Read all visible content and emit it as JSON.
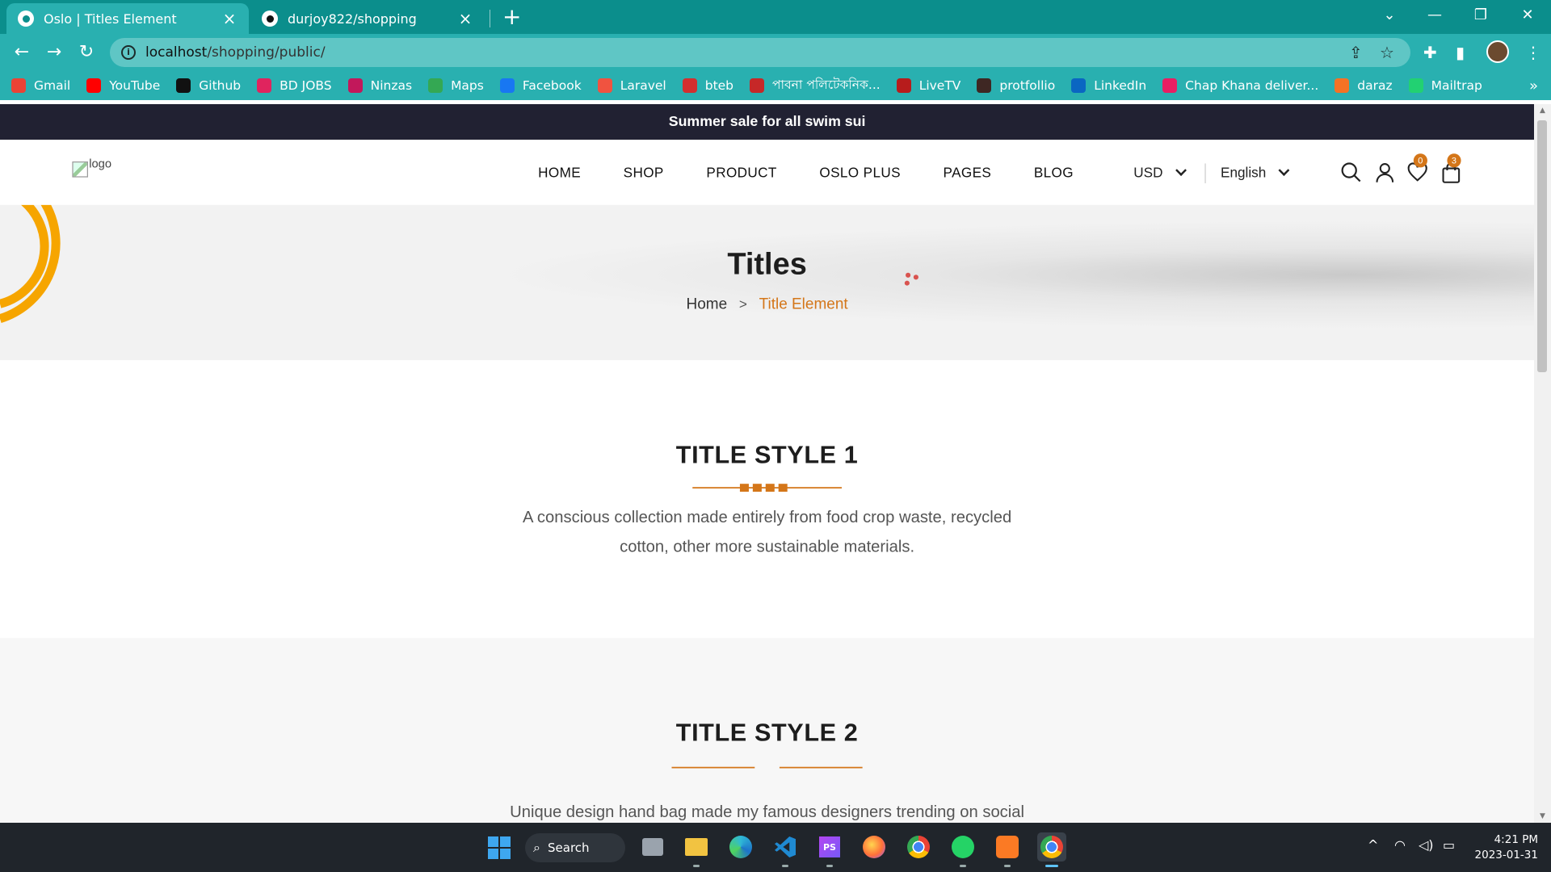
{
  "browser": {
    "tabs": [
      {
        "title": "Oslo | Titles Element",
        "active": true
      },
      {
        "title": "durjoy822/shopping",
        "active": false
      }
    ],
    "url_host": "localhost",
    "url_path": "/shopping/public/",
    "bookmarks": [
      {
        "label": "Gmail",
        "icon": "gmail-icon",
        "color": "#ea4335"
      },
      {
        "label": "YouTube",
        "icon": "youtube-icon",
        "color": "#ff0000"
      },
      {
        "label": "Github",
        "icon": "github-icon",
        "color": "#111111"
      },
      {
        "label": "BD JOBS",
        "icon": "bdjobs-icon",
        "color": "#e0245e"
      },
      {
        "label": "Ninzas",
        "icon": "ninzas-icon",
        "color": "#c2185b"
      },
      {
        "label": "Maps",
        "icon": "maps-icon",
        "color": "#34a853"
      },
      {
        "label": "Facebook",
        "icon": "facebook-icon",
        "color": "#1877f2"
      },
      {
        "label": "Laravel",
        "icon": "laravel-icon",
        "color": "#f05340"
      },
      {
        "label": "bteb",
        "icon": "bteb-icon",
        "color": "#d32f2f"
      },
      {
        "label": "পাবনা পলিটেকনিক...",
        "icon": "pabna-icon",
        "color": "#c62828"
      },
      {
        "label": "LiveTV",
        "icon": "livetv-icon",
        "color": "#b71c1c"
      },
      {
        "label": "protfollio",
        "icon": "portfolio-icon",
        "color": "#3e2723"
      },
      {
        "label": "LinkedIn",
        "icon": "linkedin-icon",
        "color": "#0a66c2"
      },
      {
        "label": "Chap Khana deliver...",
        "icon": "chapkhana-icon",
        "color": "#e91e63"
      },
      {
        "label": "daraz",
        "icon": "daraz-icon",
        "color": "#f57224"
      },
      {
        "label": "Mailtrap",
        "icon": "mailtrap-icon",
        "color": "#22d172"
      }
    ]
  },
  "site": {
    "announcement": "Summer sale for all swim sui",
    "logo_alt": "logo",
    "menu": [
      "HOME",
      "SHOP",
      "PRODUCT",
      "OSLO PLUS",
      "PAGES",
      "BLOG"
    ],
    "currency": "USD",
    "language": "English",
    "wishlist_count": "0",
    "cart_count": "3",
    "accent_color": "#d47619",
    "dark_color": "#212132"
  },
  "hero": {
    "title": "Titles",
    "breadcrumb_home": "Home",
    "breadcrumb_current": "Title Element"
  },
  "sections": [
    {
      "title": "TITLE STYLE 1",
      "text": "A conscious collection made entirely from food crop waste, recycled cotton, other more sustainable materials."
    },
    {
      "title": "TITLE STYLE 2",
      "text": "Unique design hand bag made my famous designers trending on social"
    }
  ],
  "taskbar": {
    "search_label": "Search",
    "time": "4:21 PM",
    "date": "2023-01-31"
  }
}
